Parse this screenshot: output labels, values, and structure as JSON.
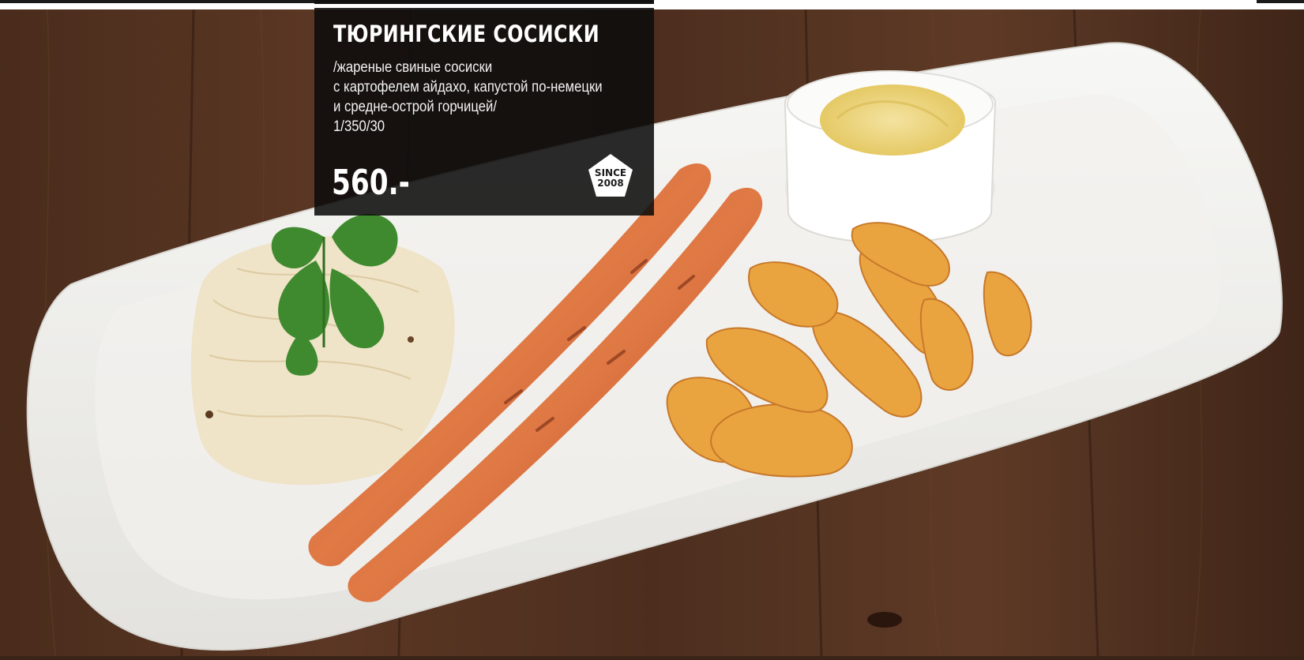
{
  "dish": {
    "title": "ТЮРИНГСКИЕ СОСИСКИ",
    "description_lines": [
      "/жареные свиные сосиски",
      "с картофелем айдахо, капустой по-немецки",
      "и средне-острой горчицей/",
      "1/350/30"
    ],
    "price": "560.-"
  },
  "badge": {
    "line1": "SINCE",
    "line2": "2008"
  },
  "colors": {
    "card": "#0c0c0c",
    "text": "#ffffff",
    "badge": "#ffffff"
  }
}
